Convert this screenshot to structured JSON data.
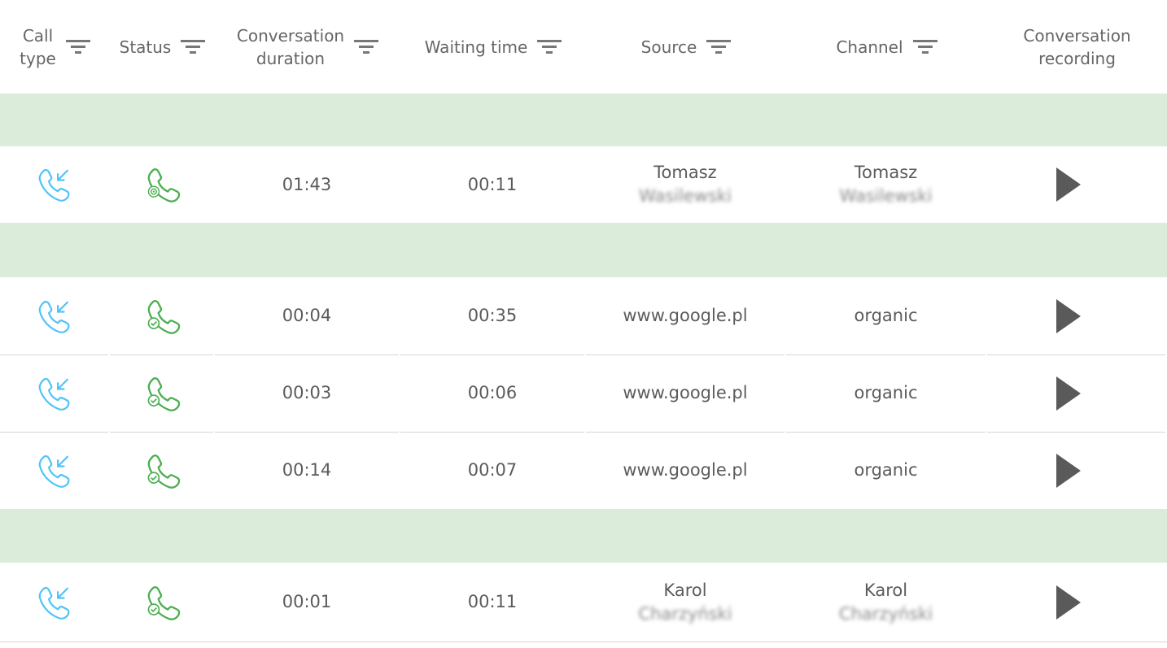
{
  "headers": [
    {
      "label": "Call\ntype",
      "filter": true
    },
    {
      "label": "Status",
      "filter": true
    },
    {
      "label": "Conversation\nduration",
      "filter": true
    },
    {
      "label": "Waiting time",
      "filter": true
    },
    {
      "label": "Source",
      "filter": true
    },
    {
      "label": "Channel",
      "filter": true
    },
    {
      "label": "Conversation\nrecording",
      "filter": false
    }
  ],
  "colors": {
    "group_row": "#dbecda",
    "incoming_icon": "#4fc3f7",
    "status_icon": "#4caf50",
    "play": "#5a5a5a"
  },
  "rows": [
    {
      "group_before": true,
      "call_type": "incoming-call-icon",
      "status": "call-target-icon",
      "duration": "01:43",
      "waiting": "00:11",
      "source": "Tomasz",
      "source_blur": "Wasilewski",
      "channel": "Tomasz",
      "channel_blur": "Wasilewski"
    },
    {
      "group_before": true,
      "call_type": "incoming-call-icon",
      "status": "call-answered-icon",
      "duration": "00:04",
      "waiting": "00:35",
      "source": "www.google.pl",
      "channel": "organic"
    },
    {
      "group_before": false,
      "call_type": "incoming-call-icon",
      "status": "call-answered-icon",
      "duration": "00:03",
      "waiting": "00:06",
      "source": "www.google.pl",
      "channel": "organic"
    },
    {
      "group_before": false,
      "call_type": "incoming-call-icon",
      "status": "call-answered-icon",
      "duration": "00:14",
      "waiting": "00:07",
      "source": "www.google.pl",
      "channel": "organic"
    },
    {
      "group_before": true,
      "call_type": "incoming-call-icon",
      "status": "call-answered-icon",
      "duration": "00:01",
      "waiting": "00:11",
      "source": "Karol",
      "source_blur": "Charzyński",
      "channel": "Karol",
      "channel_blur": "Charzyński"
    }
  ]
}
